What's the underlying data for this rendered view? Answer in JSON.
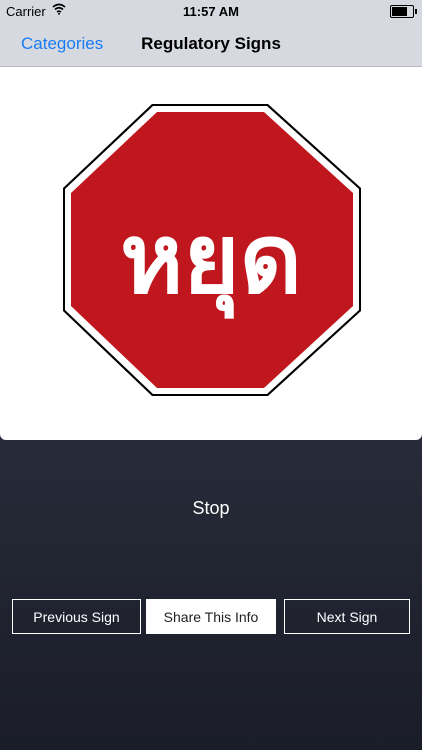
{
  "status_bar": {
    "carrier": "Carrier",
    "time": "11:57 AM"
  },
  "nav": {
    "back_label": "Categories",
    "title": "Regulatory Signs"
  },
  "sign": {
    "text": "หยุด",
    "name": "Stop",
    "colors": {
      "background": "#c0171f",
      "text": "#ffffff"
    }
  },
  "buttons": {
    "previous": "Previous Sign",
    "share": "Share This Info",
    "next": "Next Sign"
  }
}
